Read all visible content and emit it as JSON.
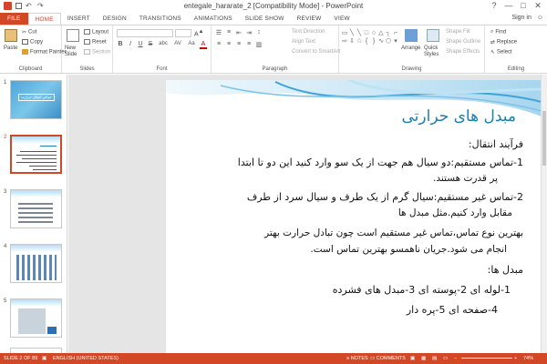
{
  "window": {
    "title": "entegale_hararate_2 [Compatibility Mode] - PowerPoint",
    "controls": [
      "?",
      "—",
      "□",
      "✕"
    ]
  },
  "tabs": [
    "FILE",
    "HOME",
    "INSERT",
    "DESIGN",
    "TRANSITIONS",
    "ANIMATIONS",
    "SLIDE SHOW",
    "REVIEW",
    "VIEW"
  ],
  "signin": "Sign in",
  "ribbon": {
    "clipboard": {
      "paste": "Paste",
      "cut": "Cut",
      "copy": "Copy",
      "format_painter": "Format Painter",
      "label": "Clipboard"
    },
    "slides": {
      "new_slide": "New Slide",
      "layout": "Layout",
      "reset": "Reset",
      "section": "Section",
      "label": "Slides"
    },
    "font": {
      "label": "Font",
      "bold": "B",
      "italic": "I",
      "underline": "U",
      "strike": "S",
      "shadow": "abc",
      "spacing": "AV",
      "case": "Aa",
      "color": "A"
    },
    "paragraph": {
      "text_direction": "Text Direction",
      "align_text": "Align Text",
      "convert_smartart": "Convert to SmartArt",
      "label": "Paragraph"
    },
    "drawing": {
      "arrange": "Arrange",
      "quick_styles": "Quick Styles",
      "shape_fill": "Shape Fill",
      "shape_outline": "Shape Outline",
      "shape_effects": "Shape Effects",
      "label": "Drawing"
    },
    "editing": {
      "find": "Find",
      "replace": "Replace",
      "select": "Select",
      "label": "Editing"
    }
  },
  "thumbnails": [
    {
      "num": "1",
      "text": "خواص انتقال حرارت"
    },
    {
      "num": "2"
    },
    {
      "num": "3"
    },
    {
      "num": "4"
    },
    {
      "num": "5"
    }
  ],
  "slide": {
    "title": "مبدل های حرارتی",
    "lines": [
      "فرآیند انتقال:",
      "1-تماس مستقیم:دو سیال هم جهت از یک سو وارد کنید این دو تا ابتدا",
      "پر قدرت هستند.",
      "2-تماس غیر مستقیم:سیال گرم از یک طرف و سیال سرد از طرف",
      "مقابل وارد کنیم.مثل مبدل ها",
      "بهترین نوع تماس،تماس غیر مستقیم است چون تبادل حرارت بهتر",
      "انجام می شود.جریان ناهمسو بهترین تماس است.",
      "مبدل ها:",
      "1-لوله ای     2-پوسته ای     3-مبدل های فشرده",
      "4-صفحه ای     5-پره دار"
    ]
  },
  "status": {
    "slide_info": "SLIDE 2 OF 89",
    "language": "ENGLISH (UNITED STATES)",
    "notes": "NOTES",
    "comments": "COMMENTS",
    "zoom": "74%",
    "colors": {
      "accent": "#d24726",
      "title_blue": "#1b7fb0"
    }
  }
}
